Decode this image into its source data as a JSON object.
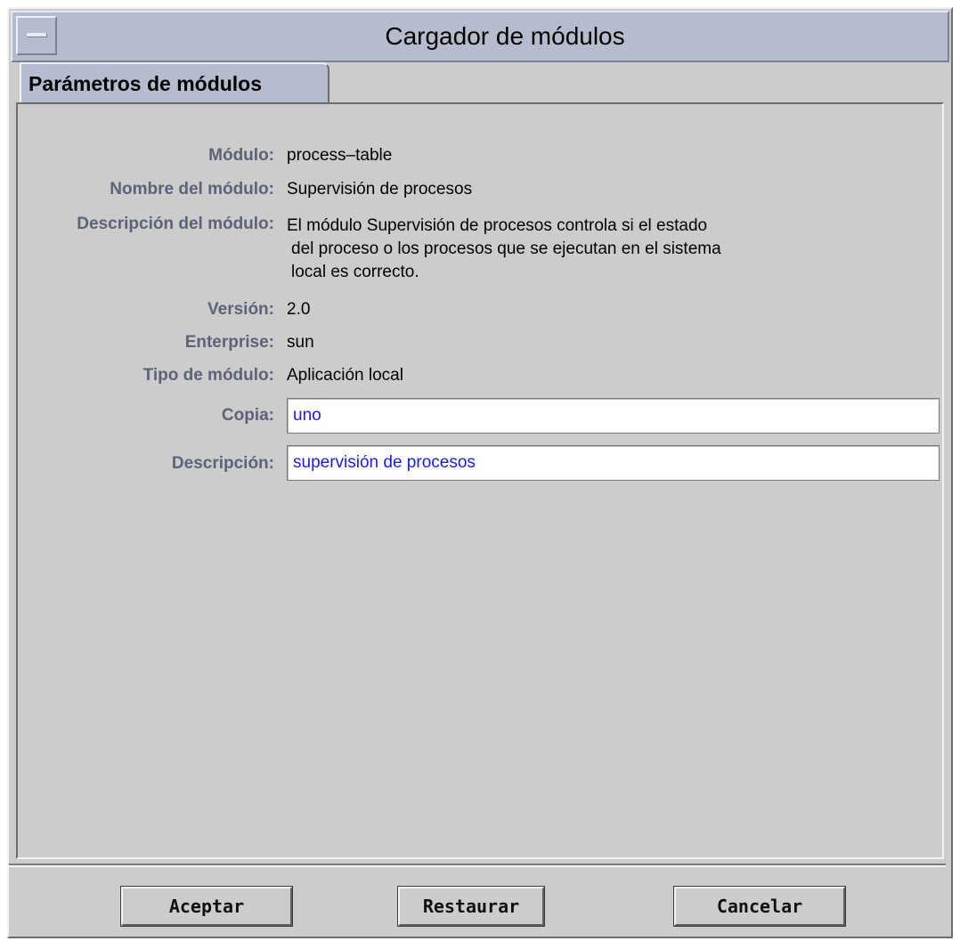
{
  "window": {
    "title": "Cargador de módulos"
  },
  "tabs": [
    {
      "label": "Parámetros de módulos",
      "selected": true
    }
  ],
  "form": {
    "module_label": "Módulo:",
    "module_value": "process–table",
    "module_name_label": "Nombre del módulo:",
    "module_name_value": "Supervisión de procesos",
    "module_desc_label": "Descripción del módulo:",
    "module_desc_lines": [
      "El módulo Supervisión de procesos controla si el estado",
      "del proceso o los procesos que se ejecutan en el sistema",
      "local es correcto."
    ],
    "version_label": "Versión:",
    "version_value": "2.0",
    "enterprise_label": "Enterprise:",
    "enterprise_value": "sun",
    "module_type_label": "Tipo de módulo:",
    "module_type_value": "Aplicación local",
    "instance_label": "Copia:",
    "instance_value": "uno",
    "description_label": "Descripción:",
    "description_value": "supervisión de procesos"
  },
  "buttons": {
    "ok": "Aceptar",
    "reset": "Restaurar",
    "cancel": "Cancelar"
  },
  "colors": {
    "window_bg": "#cccccc",
    "titlebar_bg": "#b6bcce",
    "label_text": "#5c6378",
    "input_text": "#1a1aff"
  }
}
